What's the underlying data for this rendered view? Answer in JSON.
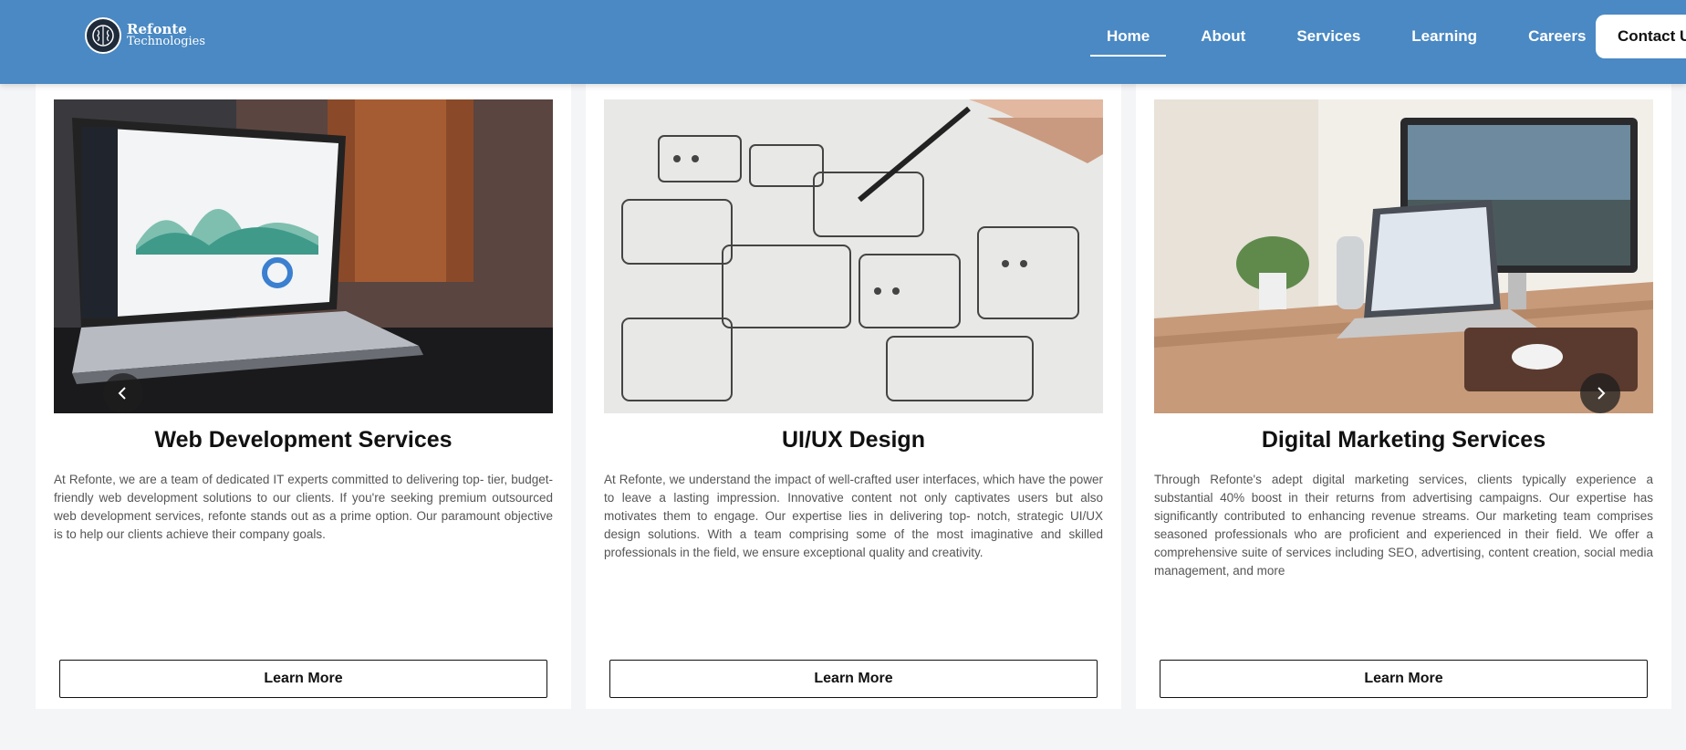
{
  "header": {
    "logo_line1": "Refonte",
    "logo_line2": "Technologies",
    "nav": [
      {
        "label": "Home",
        "active": true
      },
      {
        "label": "About"
      },
      {
        "label": "Services"
      },
      {
        "label": "Learning"
      },
      {
        "label": "Careers"
      }
    ],
    "contact_label": "Contact Us"
  },
  "carousel": {
    "prev_icon": "chevron-left-icon",
    "next_icon": "chevron-right-icon"
  },
  "cards": [
    {
      "title": "Web Development Services",
      "image": "laptop-dashboard-photo",
      "description": "At Refonte, we are a team of dedicated IT experts committed to delivering top- tier, budget-friendly web development solutions to our clients. If you're seeking premium outsourced web development services, refonte stands out as a prime option. Our paramount objective is to help our clients achieve their company goals.",
      "button": "Learn More"
    },
    {
      "title": "UI/UX Design",
      "image": "wireframe-sketch-photo",
      "description": "At Refonte, we understand the impact of well-crafted user interfaces, which have the power to leave a lasting impression. Innovative content not only captivates users but also motivates them to engage. Our expertise lies in delivering top- notch, strategic UI/UX design solutions. With a team comprising some of the most imaginative and skilled professionals in the field, we ensure exceptional quality and creativity.",
      "button": "Learn More"
    },
    {
      "title": "Digital Marketing Services",
      "image": "desk-workspace-photo",
      "description": "Through Refonte's adept digital marketing services, clients typically experience a substantial 40% boost in their returns from advertising campaigns. Our expertise has significantly contributed to enhancing revenue streams. Our marketing team comprises seasoned professionals who are proficient and experienced in their field. We offer a comprehensive suite of services including SEO, advertising, content creation, social media management, and more",
      "button": "Learn More"
    }
  ],
  "colors": {
    "header_bg": "#4a89c3",
    "page_bg": "#f4f5f7"
  }
}
